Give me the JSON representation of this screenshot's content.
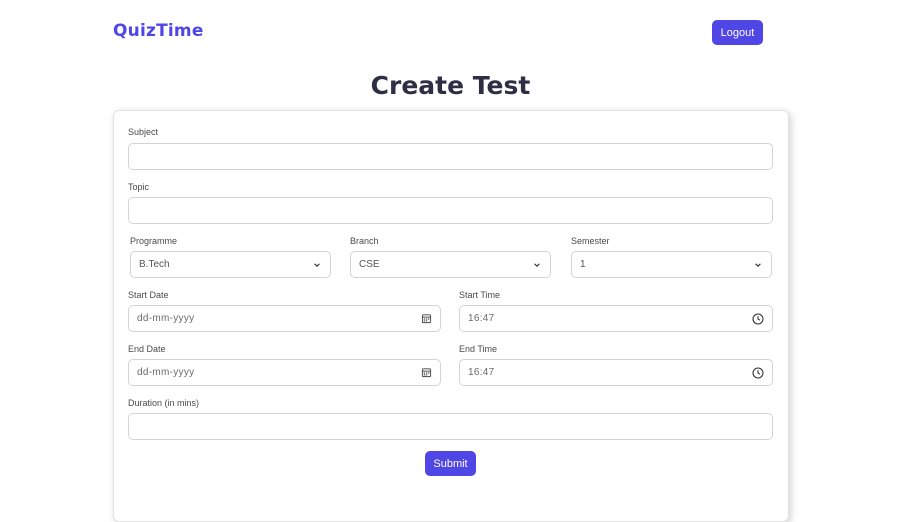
{
  "header": {
    "brand": "QuizTime",
    "logout_label": "Logout"
  },
  "page": {
    "title": "Create Test"
  },
  "form": {
    "subject": {
      "label": "Subject",
      "value": ""
    },
    "topic": {
      "label": "Topic",
      "value": ""
    },
    "programme": {
      "label": "Programme",
      "value": "B.Tech"
    },
    "branch": {
      "label": "Branch",
      "value": "CSE"
    },
    "semester": {
      "label": "Semester",
      "value": "1"
    },
    "start_date": {
      "label": "Start Date",
      "placeholder": "dd-mm-yyyy"
    },
    "start_time": {
      "label": "Start Time",
      "value": "16:47"
    },
    "end_date": {
      "label": "End Date",
      "placeholder": "dd-mm-yyyy"
    },
    "end_time": {
      "label": "End Time",
      "value": "16:47"
    },
    "duration": {
      "label": "Duration (in mins)",
      "value": ""
    },
    "submit_label": "Submit"
  },
  "icons": {
    "calendar": "calendar-icon",
    "clock": "clock-icon",
    "chevron": "chevron-down-icon"
  },
  "colors": {
    "accent": "#4f46e5",
    "title": "#2d2f45",
    "border": "#d4d4d8"
  }
}
